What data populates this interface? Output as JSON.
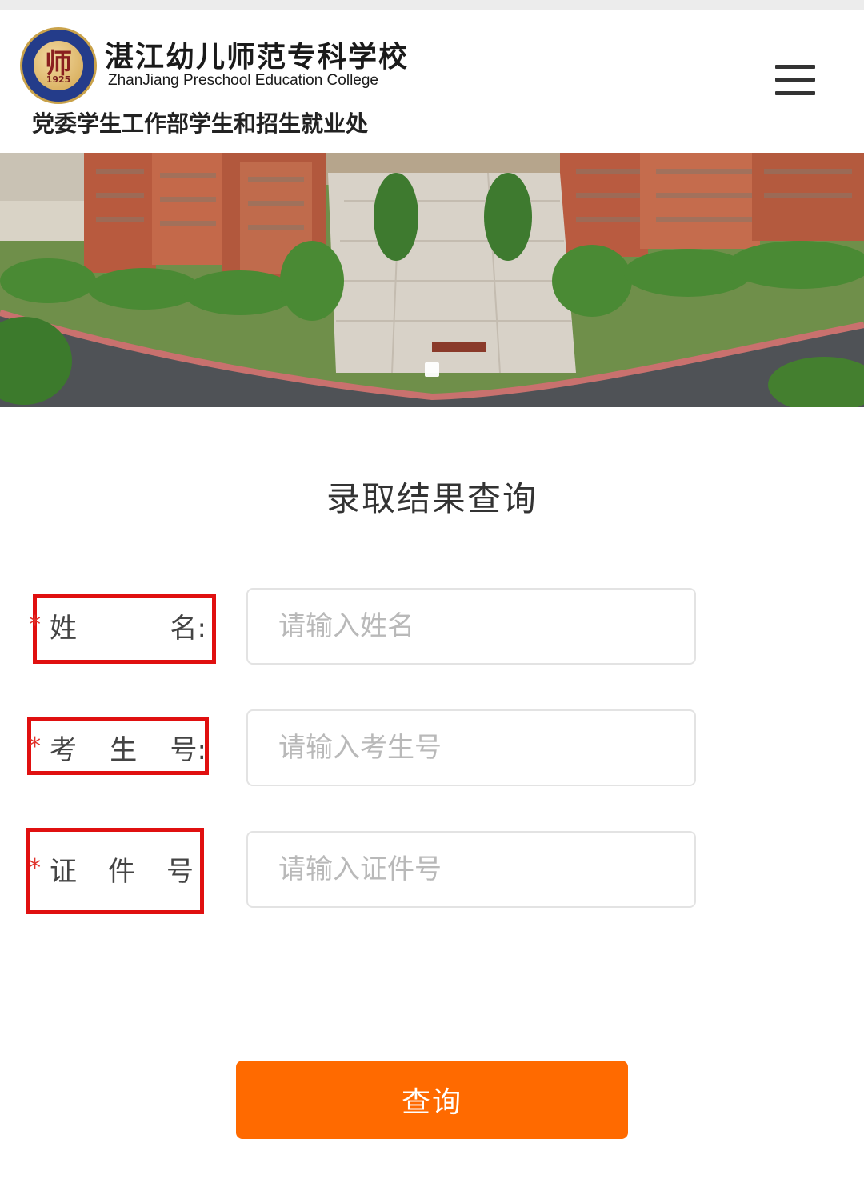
{
  "header": {
    "logo_glyph": "师",
    "logo_year": "1925",
    "school_name_cn": "湛江幼儿师范专科学校",
    "school_name_en": "ZhanJiang Preschool Education College",
    "department": "党委学生工作部学生和招生就业处",
    "menu_icon": "hamburger-menu-icon"
  },
  "banner": {
    "image": "campus aerial view",
    "slides_indicator": "single-dot"
  },
  "form": {
    "title": "录取结果查询",
    "fields": [
      {
        "label_chars": [
          "姓",
          "名:"
        ],
        "required_mark": "*",
        "placeholder": "请输入姓名",
        "value": ""
      },
      {
        "label_chars": [
          "考",
          "生",
          "号:"
        ],
        "required_mark": "*",
        "placeholder": "请输入考生号",
        "value": ""
      },
      {
        "label_chars": [
          "证",
          "件",
          "号"
        ],
        "required_mark": "*",
        "placeholder": "请输入证件号",
        "value": ""
      }
    ],
    "submit_label": "查询"
  },
  "colors": {
    "accent": "#ff6a00",
    "highlight_box": "#e01010",
    "required": "#e0322b",
    "placeholder": "#b9b9b9"
  }
}
